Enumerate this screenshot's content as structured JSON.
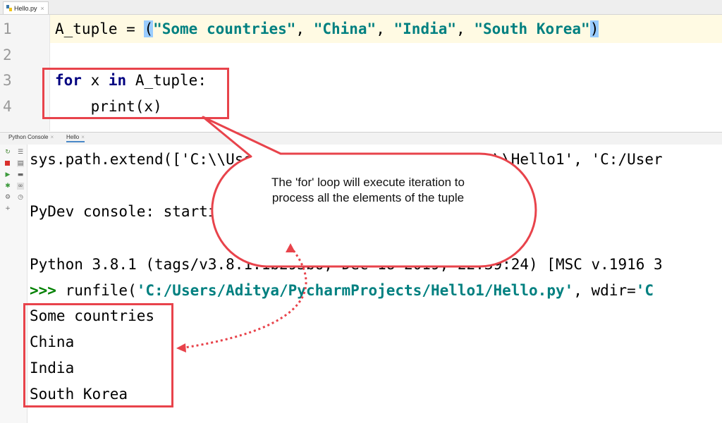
{
  "editor": {
    "tab_label": "Hello.py",
    "tab_close": "×",
    "line_numbers": [
      "1",
      "2",
      "3",
      "4"
    ],
    "lines": {
      "l1": {
        "var": "A_tuple",
        "op": " = ",
        "open": "(",
        "s1": "\"Some countries\"",
        "sep1": ", ",
        "s2": "\"China\"",
        "sep2": ", ",
        "s3": "\"India\"",
        "sep3": ", ",
        "s4": "\"South Korea\"",
        "close": ")"
      },
      "l3": {
        "kw_for": "for",
        "mid1": " x ",
        "kw_in": "in",
        "rest": " A_tuple:"
      },
      "l4": "    print(x)"
    },
    "highlight_color": "#99ccff"
  },
  "console_panel": {
    "tabs": [
      "Python Console",
      "Hello"
    ],
    "tab_close": "×",
    "toolbar_icons": [
      "rerun-icon",
      "stop-icon",
      "run-icon",
      "debug-icon",
      "settings-icon",
      "add-icon",
      "soft-wrap-icon",
      "print-icon",
      "variables-icon",
      "history-icon"
    ],
    "lines": {
      "path_extend": "sys.path.extend(['C:\\\\Users\\\\Aditya\\\\PycharmProjects\\\\Hello1', 'C:/User",
      "pydev": "PyDev console: starting.",
      "version": "Python 3.8.1 (tags/v3.8.1:1b293b6, Dec 18 2019, 22:39:24) [MSC v.1916 3",
      "prompt": ">>> ",
      "run_pre": "runfile(",
      "run_path": "'C:/Users/Aditya/PycharmProjects/Hello1/Hello.py'",
      "run_mid": ", wdir=",
      "run_tail": "'C"
    },
    "output": [
      "Some countries",
      "China",
      "India",
      "South Korea"
    ]
  },
  "callout": {
    "text": "The 'for' loop will execute iteration to process all the elements of the tuple"
  },
  "colors": {
    "annotation_red": "#e8434b",
    "keyword": "#000080",
    "string": "#008080",
    "prompt": "#008000"
  }
}
